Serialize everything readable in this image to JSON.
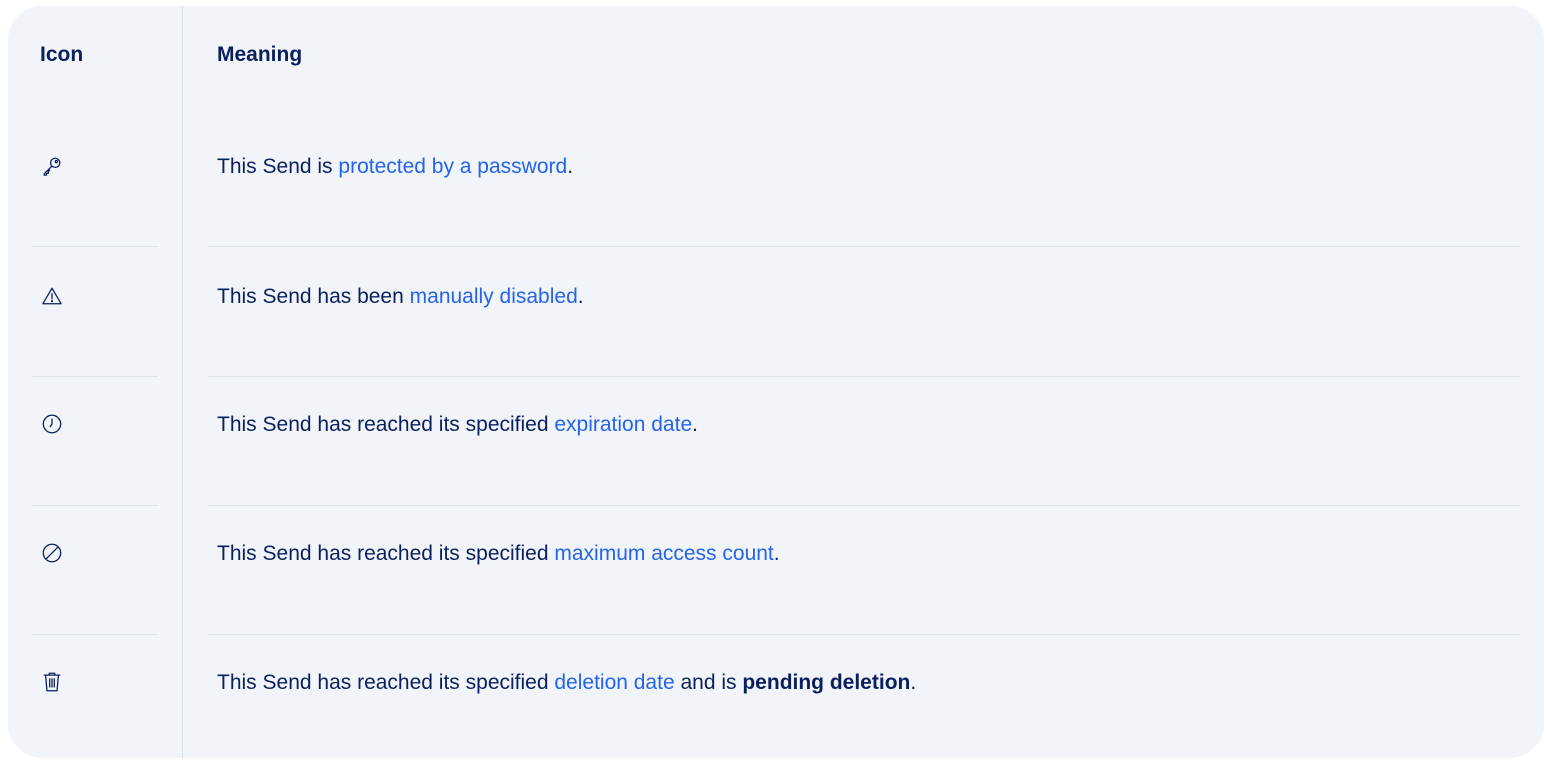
{
  "table": {
    "header": {
      "icon": "Icon",
      "meaning": "Meaning"
    },
    "rows": [
      {
        "icon": "key-icon",
        "pre": "This Send is ",
        "link": "protected by a password",
        "post": "."
      },
      {
        "icon": "warning-icon",
        "pre": "This Send has been ",
        "link": "manually disabled",
        "post": "."
      },
      {
        "icon": "clock-icon",
        "pre": "This Send has reached its specified ",
        "link": "expiration date",
        "post": "."
      },
      {
        "icon": "prohibited-icon",
        "pre": "This Send has reached its specified ",
        "link": "maximum access count",
        "post": "."
      },
      {
        "icon": "trash-icon",
        "pre": "This Send has reached its specified ",
        "link": "deletion date",
        "mid": " and is ",
        "bold": "pending deletion",
        "post": "."
      }
    ]
  },
  "colors": {
    "card_bg": "#f1f5f9",
    "text": "#0b1f5e",
    "link": "#2563eb",
    "divider": "#dde3ea"
  }
}
